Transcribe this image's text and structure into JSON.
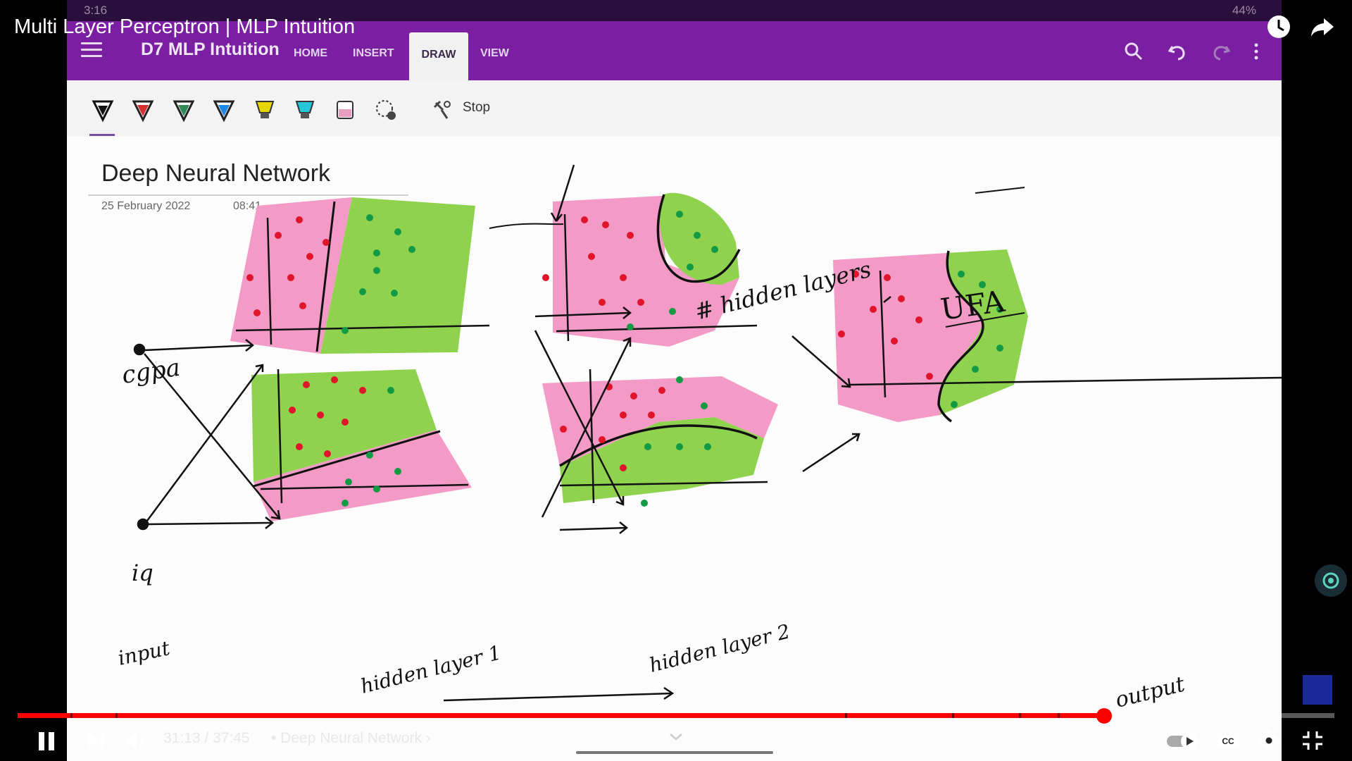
{
  "video": {
    "title": "Multi Layer Perceptron | MLP Intuition",
    "current_time": "31:13",
    "duration": "37:45",
    "time_display": "31:13 / 37:45",
    "chapter_display": "• Deep Neural Network ›",
    "progress_fraction": 0.825
  },
  "device_status": {
    "time": "3:16",
    "battery": "44%"
  },
  "onenote": {
    "notebook_title": "D7 MLP Intuition",
    "tabs": [
      "HOME",
      "INSERT",
      "DRAW",
      "VIEW"
    ],
    "active_tab": "DRAW",
    "stop_label": "Stop",
    "pen_colors": [
      "#111111",
      "#d32f2f",
      "#2e8b57",
      "#1e88e5",
      "#e6d600",
      "#26c6da",
      "#e8a0c0"
    ]
  },
  "page": {
    "title": "Deep Neural Network",
    "date": "25 February 2022",
    "time": "08:41"
  },
  "sketch_labels": {
    "input_1": "cgpa",
    "input_2": "iq",
    "input_caption": "input",
    "hidden1": "hidden layer 1",
    "hidden2": "hidden layer 2",
    "hidden_layers_note": "# hidden layers",
    "ufa": "UFA",
    "output": "output"
  },
  "colors": {
    "pink": "#f39ac6",
    "green": "#8fd24e",
    "red_dot": "#e0142a",
    "green_dot": "#139a44",
    "ribbon": "#7a1fa2",
    "progress": "#ff0000"
  }
}
